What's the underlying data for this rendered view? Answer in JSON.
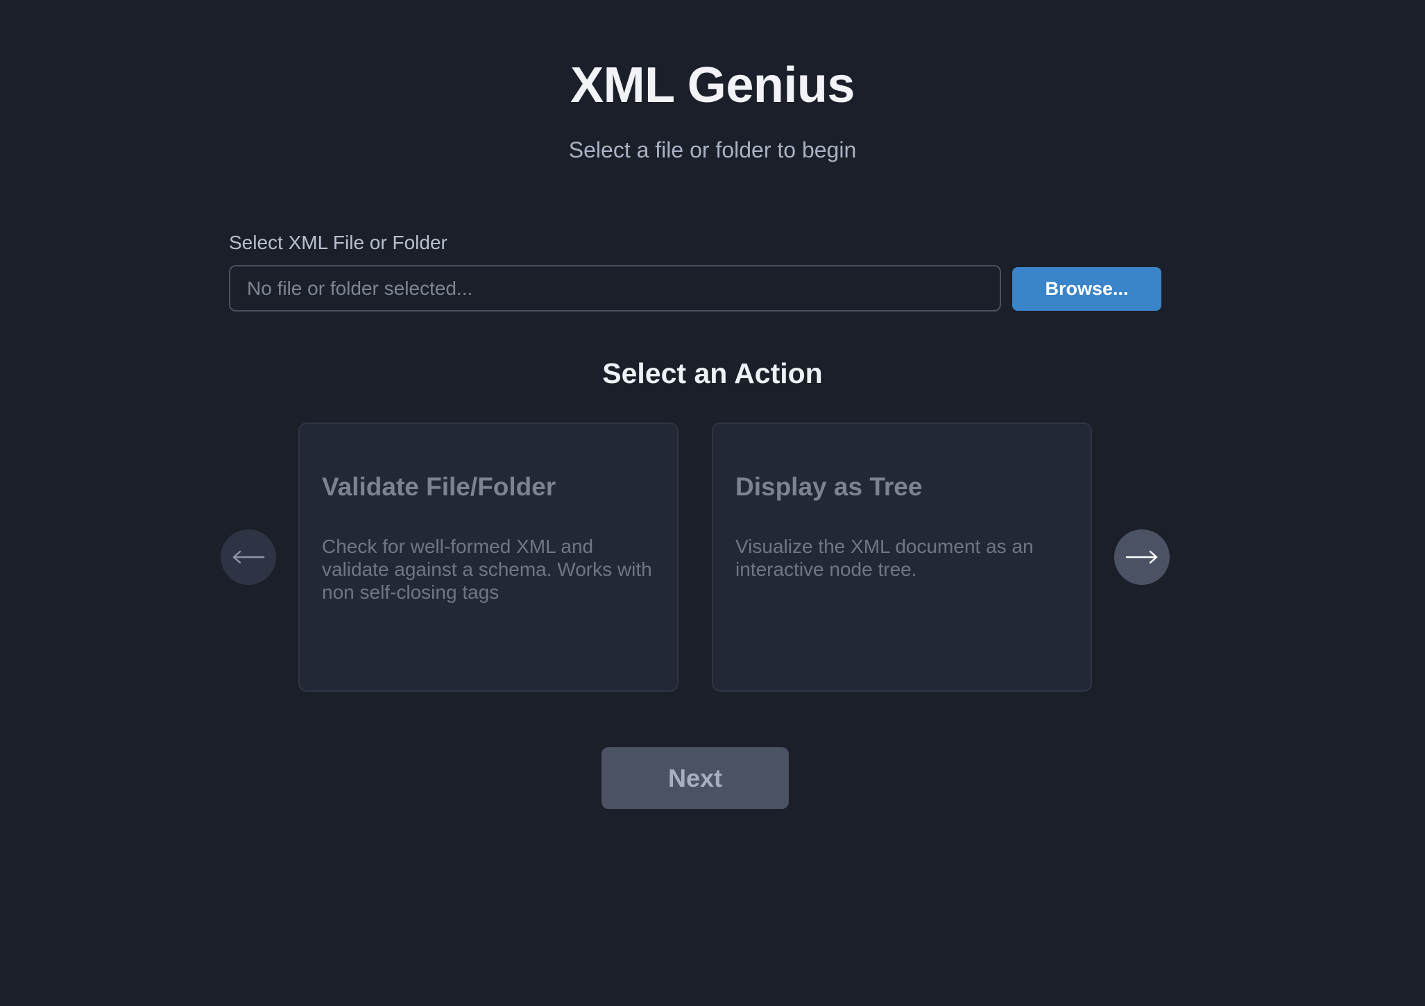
{
  "header": {
    "title": "XML Genius",
    "subtitle": "Select a file or folder to begin"
  },
  "file_select": {
    "label": "Select XML File or Folder",
    "value": "",
    "placeholder": "No file or folder selected...",
    "browse_label": "Browse..."
  },
  "actions": {
    "heading": "Select an Action",
    "prev_icon": "arrow-left-icon",
    "next_icon": "arrow-right-icon",
    "cards": [
      {
        "title": "Validate File/Folder",
        "description": "Check for well-formed XML and validate against a schema. Works with non self-closing tags"
      },
      {
        "title": "Display as Tree",
        "description": "Visualize the XML document as an interactive node tree."
      }
    ]
  },
  "footer": {
    "next_label": "Next"
  },
  "colors": {
    "background": "#1b1f29",
    "accent": "#3a84c9",
    "card_background": "#232836",
    "disabled_button": "#4a5263"
  }
}
